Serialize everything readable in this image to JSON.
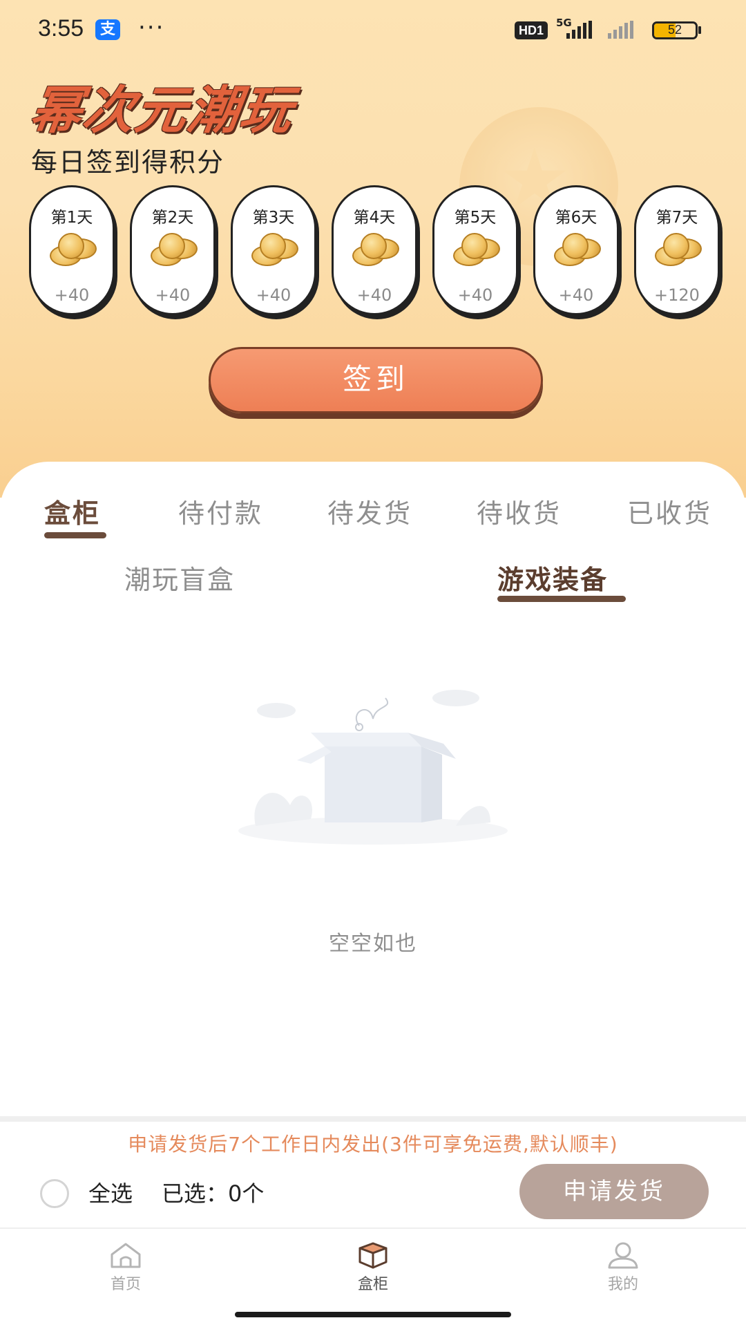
{
  "status_bar": {
    "time": "3:55",
    "alipay_glyph": "支",
    "more_dots": "···",
    "hd_label": "HD1",
    "network": "5G",
    "battery": "52"
  },
  "header": {
    "brand": "幂次元潮玩",
    "subtitle": "每日签到得积分"
  },
  "checkin": {
    "days": [
      {
        "label": "第1天",
        "points": "+40"
      },
      {
        "label": "第2天",
        "points": "+40"
      },
      {
        "label": "第3天",
        "points": "+40"
      },
      {
        "label": "第4天",
        "points": "+40"
      },
      {
        "label": "第5天",
        "points": "+40"
      },
      {
        "label": "第6天",
        "points": "+40"
      },
      {
        "label": "第7天",
        "points": "+120"
      }
    ],
    "button_label": "签到"
  },
  "tabs": [
    {
      "label": "盒柜",
      "active": true
    },
    {
      "label": "待付款",
      "active": false
    },
    {
      "label": "待发货",
      "active": false
    },
    {
      "label": "待收货",
      "active": false
    },
    {
      "label": "已收货",
      "active": false
    }
  ],
  "subtabs": [
    {
      "label": "潮玩盲盒",
      "active": false
    },
    {
      "label": "游戏装备",
      "active": true
    }
  ],
  "empty_state": {
    "icon": "empty-box-icon",
    "text": "空空如也"
  },
  "footer": {
    "notice": "申请发货后7个工作日内发出(3件可享免运费,默认顺丰)",
    "select_all": "全选",
    "selected": "已选：0个",
    "apply_button": "申请发货"
  },
  "bottom_nav": [
    {
      "label": "首页",
      "icon": "home-icon",
      "active": false
    },
    {
      "label": "盒柜",
      "icon": "box-icon",
      "active": true
    },
    {
      "label": "我的",
      "icon": "user-icon",
      "active": false
    }
  ],
  "colors": {
    "accent": "#ee7f55",
    "brand_text": "#e2623c",
    "active_tab": "#6b4c3b",
    "notice": "#e58a5c",
    "apply_button": "#b8a39a"
  }
}
